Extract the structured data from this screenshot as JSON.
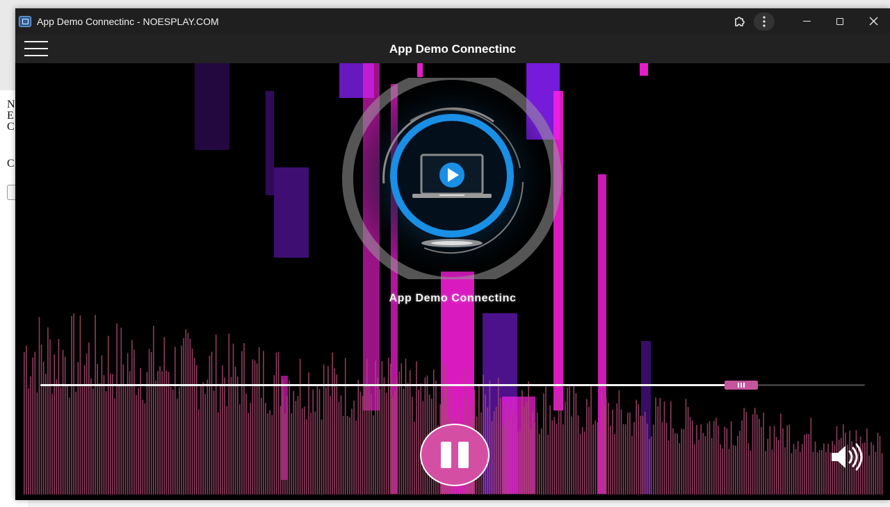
{
  "window": {
    "title": "App Demo Connectinc - NOESPLAY.COM",
    "icons": {
      "app": "app-icon",
      "extensions": "puzzle-icon",
      "menu": "more-vertical-icon",
      "minimize": "minimize-icon",
      "maximize": "maximize-icon",
      "close": "close-icon"
    }
  },
  "background_page": {
    "letters": [
      "N",
      "E",
      "C"
    ],
    "letter2": "C"
  },
  "app_bar": {
    "title": "App Demo Connectinc",
    "menu_icon": "hamburger-icon"
  },
  "player": {
    "station_name": "App Demo Connectinc",
    "logo_icon": "laptop-play-icon",
    "progress": 0.85,
    "state": "playing",
    "pause_icon": "pause-icon",
    "volume_icon": "volume-icon",
    "colors": {
      "accent": "#d44fa4",
      "spectrum": "#a8486f",
      "ring_blue": "#1a8fe6",
      "neon_magenta": "#ff1fe0",
      "neon_violet": "#8a20ff"
    }
  }
}
